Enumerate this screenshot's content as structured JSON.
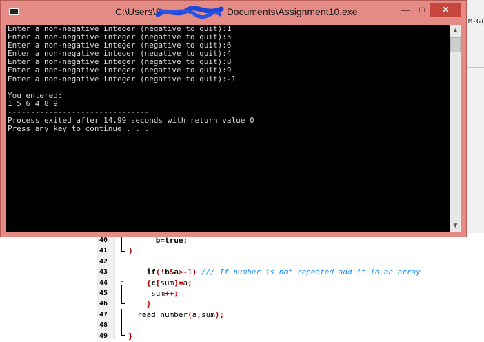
{
  "console": {
    "title": "C:\\Users\\S",
    "title_suffix": "Documents\\Assignment10.exe",
    "lines": [
      "Enter a non-negative integer (negative to quit):1",
      "Enter a non-negative integer (negative to quit):5",
      "Enter a non-negative integer (negative to quit):6",
      "Enter a non-negative integer (negative to quit):4",
      "Enter a non-negative integer (negative to quit):8",
      "Enter a non-negative integer (negative to quit):9",
      "Enter a non-negative integer (negative to quit):-1",
      "",
      "You entered:",
      "1 5 6 4 8 9",
      "-------------------------------",
      "Process exited after 14.99 seconds with return value 0",
      "Press any key to continue . . ."
    ],
    "buttons": {
      "minimize": "—",
      "maximize": "□",
      "close": "✕"
    },
    "scroll_up": "▲",
    "scroll_down": "▼"
  },
  "ide": {
    "right_edge_text": "M-G(",
    "code_lines": [
      {
        "num": "40",
        "parts": [
          [
            "",
            "      "
          ],
          [
            "kw",
            "b"
          ],
          [
            "sym",
            "="
          ],
          [
            "kw",
            "true"
          ],
          [
            "sym",
            ";"
          ]
        ]
      },
      {
        "num": "41",
        "parts": [
          [
            "sym",
            "}"
          ]
        ]
      },
      {
        "num": "42",
        "parts": []
      },
      {
        "num": "43",
        "parts": [
          [
            "",
            "    "
          ],
          [
            "kw",
            "if"
          ],
          [
            "sym",
            "(!"
          ],
          [
            "kw",
            "b"
          ],
          [
            "sym",
            "&"
          ],
          [
            "kw",
            "a"
          ],
          [
            "sym",
            ">-"
          ],
          [
            "num",
            "1"
          ],
          [
            "sym",
            ")"
          ],
          [
            "cmt",
            " /// If number is not repeated add it in an array"
          ]
        ]
      },
      {
        "num": "44",
        "parts": [
          [
            "",
            "    "
          ],
          [
            "sym",
            "{"
          ],
          [
            "kw",
            "c"
          ],
          [
            "sym",
            "["
          ],
          [
            "",
            "sum"
          ],
          [
            "sym",
            "]="
          ],
          [
            "",
            "a"
          ],
          [
            "sym",
            ";"
          ]
        ]
      },
      {
        "num": "45",
        "parts": [
          [
            "",
            "     sum"
          ],
          [
            "sym",
            "++;"
          ]
        ]
      },
      {
        "num": "46",
        "parts": [
          [
            "",
            "    "
          ],
          [
            "sym",
            "}"
          ]
        ]
      },
      {
        "num": "47",
        "parts": [
          [
            "",
            "  read_number"
          ],
          [
            "sym",
            "("
          ],
          [
            "",
            "a"
          ],
          [
            "sym",
            ","
          ],
          [
            "",
            "sum"
          ],
          [
            "sym",
            ");"
          ]
        ]
      },
      {
        "num": "48",
        "parts": []
      },
      {
        "num": "49",
        "parts": [
          [
            "sym",
            "}"
          ]
        ]
      }
    ]
  }
}
